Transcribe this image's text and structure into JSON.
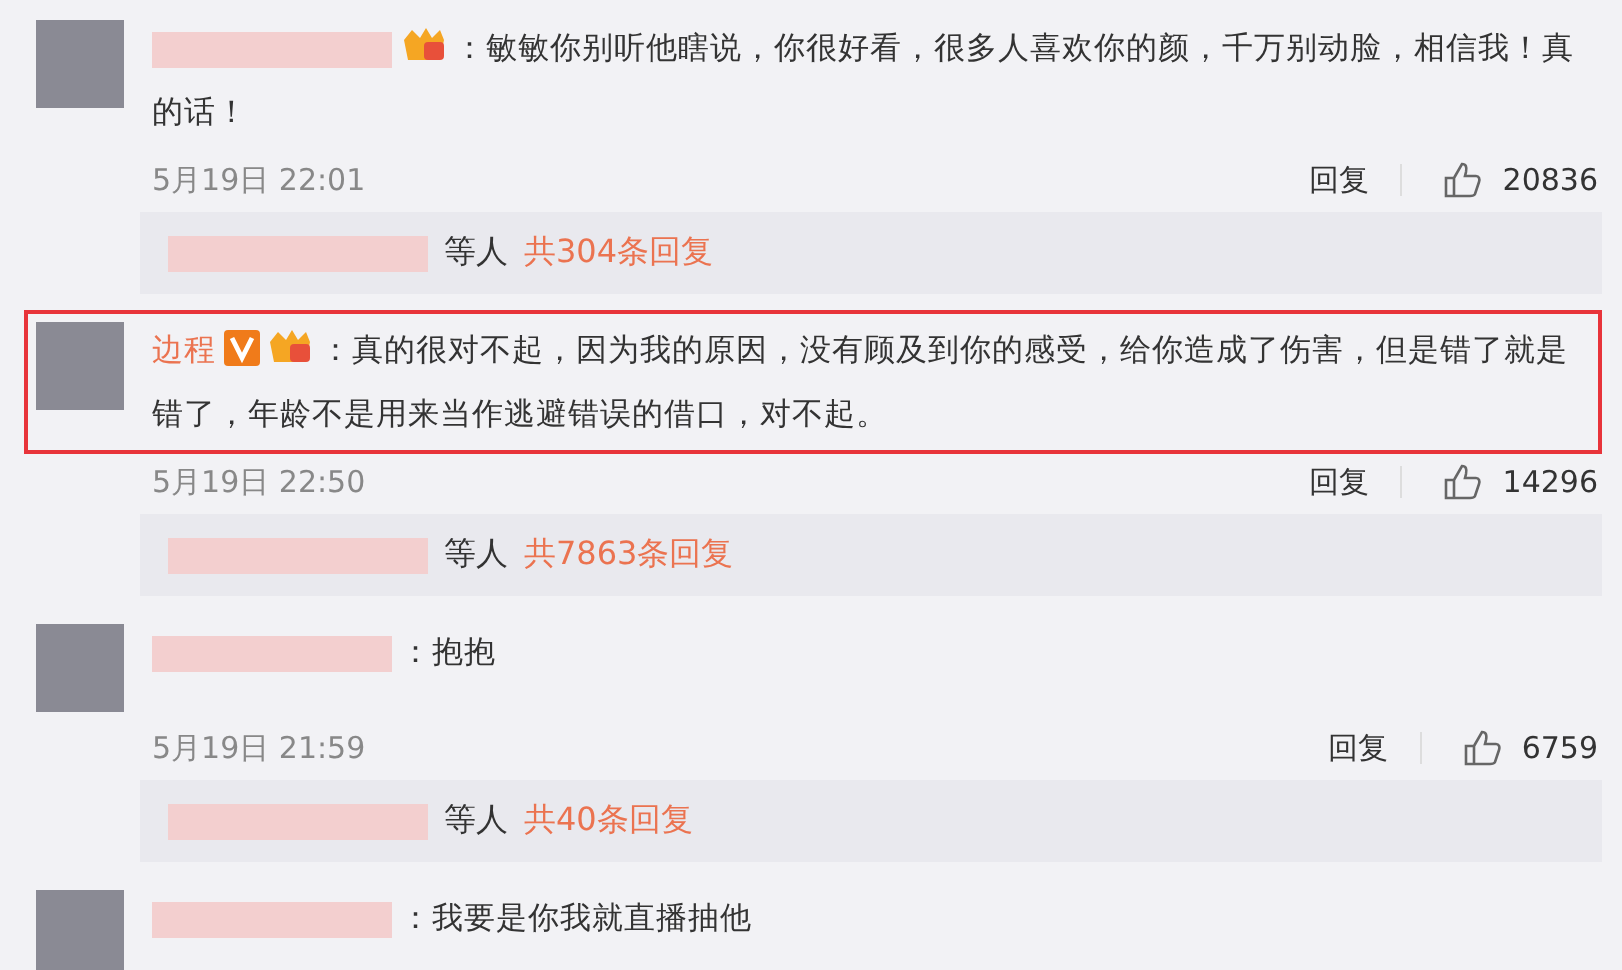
{
  "comments": [
    {
      "name_blurred": true,
      "level_badge": true,
      "text": "：敏敏你别听他瞎说，你很好看，很多人喜欢你的颜，千万别动脸，相信我！真的话！",
      "time": "5月19日 22:01",
      "reply": "回复",
      "likes": "20836",
      "sub": {
        "suffix": "等人",
        "count": "共304条回复"
      }
    },
    {
      "name": "边程",
      "verified": true,
      "level_badge": true,
      "highlighted": true,
      "text": "：真的很对不起，因为我的原因，没有顾及到你的感受，给你造成了伤害，但是错了就是错了，年龄不是用来当作逃避错误的借口，对不起。",
      "time": "5月19日 22:50",
      "reply": "回复",
      "likes": "14296",
      "sub": {
        "suffix": "等人",
        "count": "共7863条回复"
      }
    },
    {
      "name_blurred": true,
      "text": "：抱抱",
      "time": "5月19日 21:59",
      "reply": "回复",
      "likes": "6759",
      "sub": {
        "suffix": "等人",
        "count": "共40条回复"
      }
    },
    {
      "name_blurred": true,
      "text": "：我要是你我就直播抽他"
    }
  ]
}
